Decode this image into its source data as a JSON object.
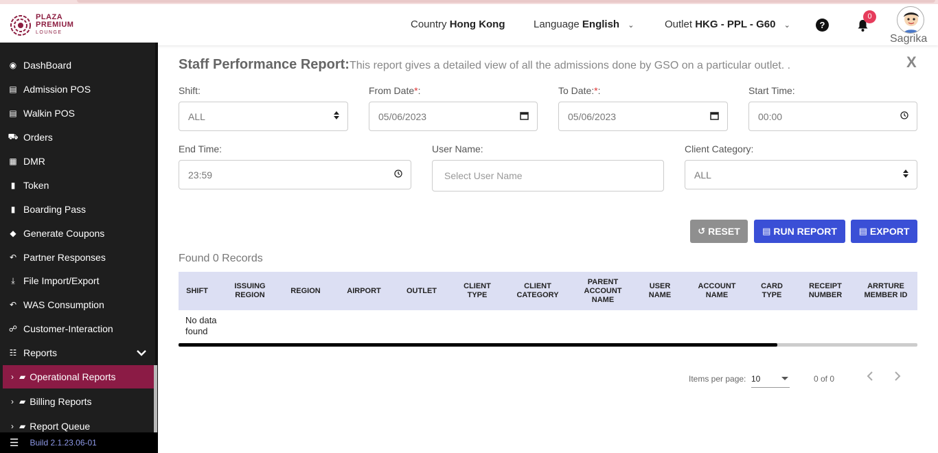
{
  "header": {
    "logo": {
      "line1": "PLAZA",
      "line2": "PREMIUM",
      "line3": "LOUNGE"
    },
    "country_label": "Country",
    "country_value": "Hong Kong",
    "language_label": "Language",
    "language_value": "English",
    "outlet_label": "Outlet",
    "outlet_value": "HKG - PPL - G60",
    "notification_count": "0",
    "user_name": "Sagrika",
    "help_icon": "question-circle-icon",
    "bell_icon": "bell-icon"
  },
  "sidebar": {
    "items": [
      {
        "label": "DashBoard",
        "icon": "dashboard-icon",
        "glyph": "◉"
      },
      {
        "label": "Admission POS",
        "icon": "id-card-icon",
        "glyph": "▤"
      },
      {
        "label": "Walkin POS",
        "icon": "id-card-icon",
        "glyph": "▤"
      },
      {
        "label": "Orders",
        "icon": "cart-icon",
        "glyph": "⛟"
      },
      {
        "label": "DMR",
        "icon": "calendar-icon",
        "glyph": "▦"
      },
      {
        "label": "Token",
        "icon": "file-icon",
        "glyph": "▮"
      },
      {
        "label": "Boarding Pass",
        "icon": "file-icon",
        "glyph": "▮"
      },
      {
        "label": "Generate Coupons",
        "icon": "tag-icon",
        "glyph": "◆"
      },
      {
        "label": "Partner Responses",
        "icon": "reply-icon",
        "glyph": "↶"
      },
      {
        "label": "File Import/Export",
        "icon": "download-icon",
        "glyph": "⤓"
      },
      {
        "label": "WAS Consumption",
        "icon": "reply-icon",
        "glyph": "↶"
      },
      {
        "label": "Customer-Interaction",
        "icon": "comments-icon",
        "glyph": "☍"
      },
      {
        "label": "Reports",
        "icon": "sitemap-icon",
        "glyph": "☷"
      }
    ],
    "subitems": [
      {
        "label": "Operational Reports",
        "active": true
      },
      {
        "label": "Billing Reports",
        "active": false
      },
      {
        "label": "Report Queue",
        "active": false
      }
    ],
    "build": "Build 2.1.23.06-01"
  },
  "report": {
    "title": "Staff Performance Report:",
    "description": "This report gives a detailed view of all the admissions done by GSO on a particular outlet. .",
    "close": "X"
  },
  "filters": {
    "shift_label": "Shift:",
    "shift_value": "ALL",
    "from_label": "From Date",
    "from_value": "05/06/2023",
    "to_label": "To Date:",
    "to_value": "05/06/2023",
    "start_label": "Start Time:",
    "start_value": "00:00",
    "end_label": "End Time:",
    "end_value": "23:59",
    "user_label": "User Name:",
    "user_placeholder": "Select User Name",
    "client_label": "Client Category:",
    "client_value": "ALL",
    "required_mark": "*",
    "from_colon": ":"
  },
  "actions": {
    "reset": "RESET",
    "run": "RUN REPORT",
    "export": "EXPORT"
  },
  "table": {
    "found": "Found 0 Records",
    "columns": [
      "SHIFT",
      "ISSUING REGION",
      "REGION",
      "AIRPORT",
      "OUTLET",
      "CLIENT TYPE",
      "CLIENT CATEGORY",
      "PARENT ACCOUNT NAME",
      "USER NAME",
      "ACCOUNT NAME",
      "CARD TYPE",
      "RECEIPT NUMBER",
      "ARRTURE MEMBER ID"
    ],
    "empty": "No data found",
    "scroll_fraction": 0.81
  },
  "pagination": {
    "items_label": "Items per page:",
    "page_size": "10",
    "range": "0 of 0"
  },
  "colors": {
    "brand": "#8b1b45",
    "primary": "#3a4fd6",
    "sidebar": "#1e1e1e"
  }
}
